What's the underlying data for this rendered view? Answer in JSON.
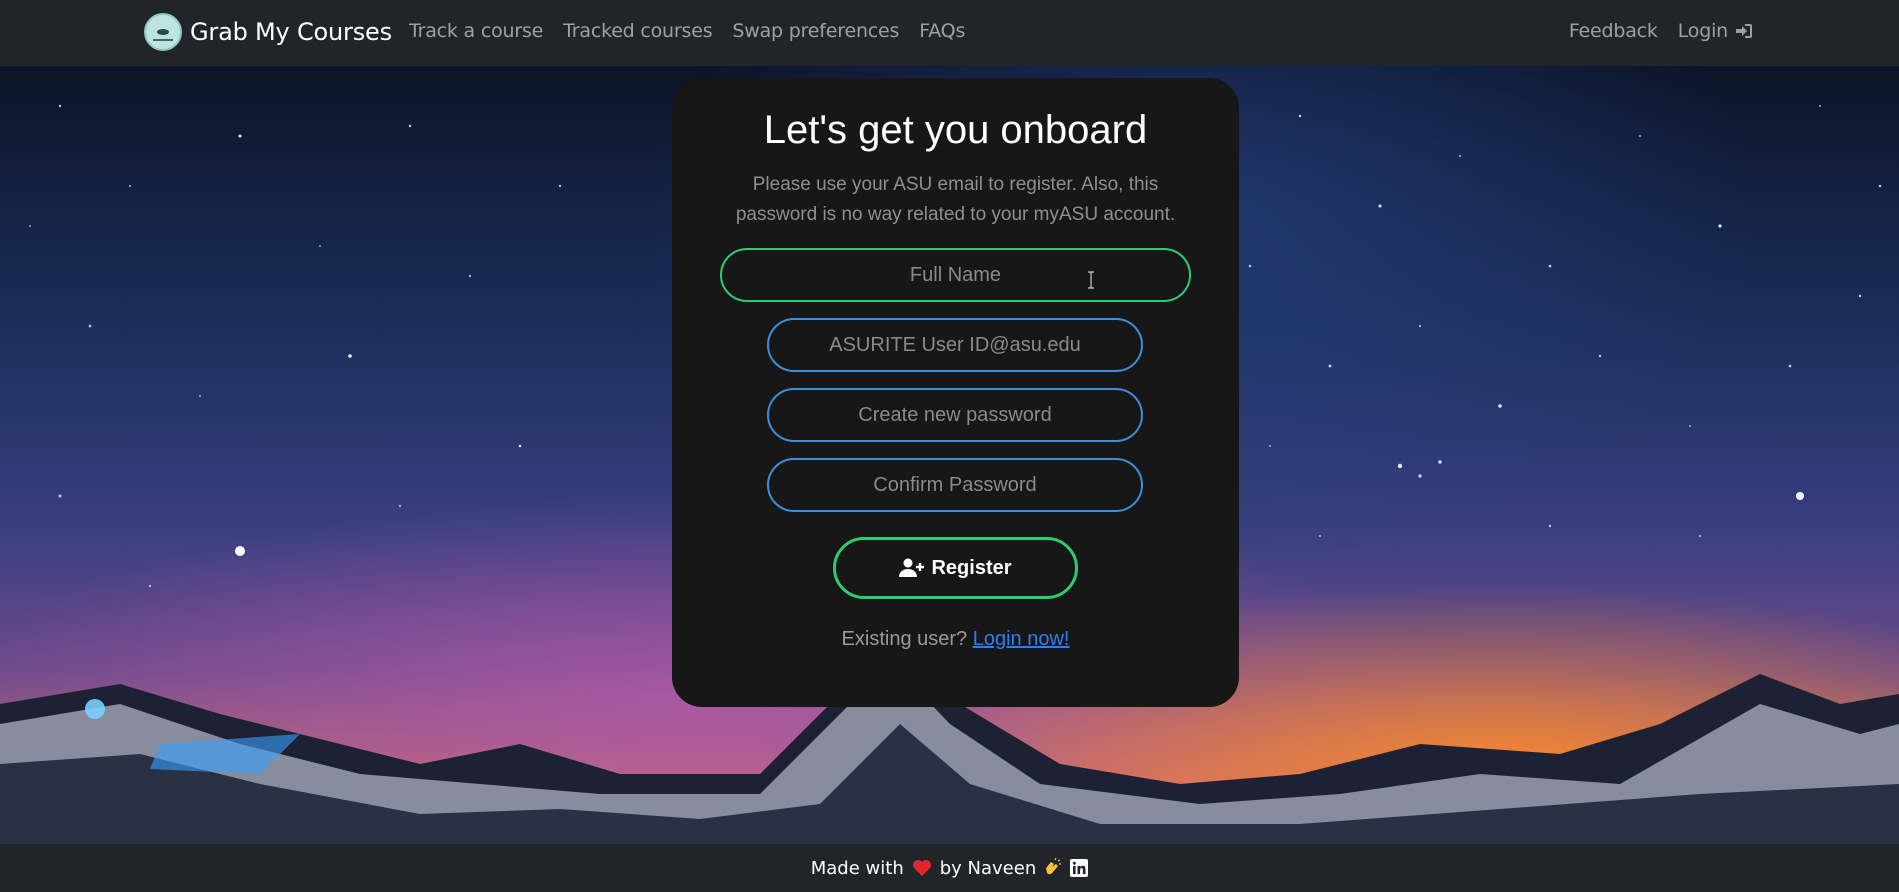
{
  "navbar": {
    "brand": "Grab My Courses",
    "links": [
      "Track a course",
      "Tracked courses",
      "Swap preferences",
      "FAQs"
    ],
    "feedback": "Feedback",
    "login": "Login",
    "login_icon": "sign-in-icon"
  },
  "form": {
    "title": "Let's get you onboard",
    "subtitle": "Please use your ASU email to register. Also, this password is no way related to your myASU account.",
    "full_name_placeholder": "Full Name",
    "email_placeholder": "ASURITE User ID@asu.edu",
    "password_placeholder": "Create new password",
    "confirm_placeholder": "Confirm Password",
    "register_label": "Register",
    "register_icon": "user-plus-icon",
    "existing_text": "Existing user?",
    "login_now": "Login now!"
  },
  "footer": {
    "made_with": "Made with",
    "by": "by Naveen"
  },
  "colors": {
    "background": "#212529",
    "card": "#171717",
    "green_border": "#2ecc71",
    "blue_border": "#3a8fd8",
    "link": "#2f7df6"
  }
}
